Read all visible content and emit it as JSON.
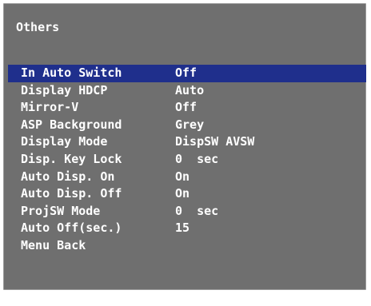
{
  "menu": {
    "title": "Others",
    "items": [
      {
        "label": "In Auto Switch",
        "value": "Off"
      },
      {
        "label": "Display HDCP",
        "value": "Auto"
      },
      {
        "label": "Mirror-V",
        "value": "Off"
      },
      {
        "label": "ASP Background",
        "value": "Grey"
      },
      {
        "label": "Display Mode",
        "value": "DispSW AVSW"
      },
      {
        "label": "Disp. Key Lock",
        "value": "0  sec"
      },
      {
        "label": "Auto Disp. On",
        "value": "On"
      },
      {
        "label": "Auto Disp. Off",
        "value": "On"
      },
      {
        "label": "ProjSW Mode",
        "value": "0  sec"
      },
      {
        "label": "Auto Off(sec.)",
        "value": "15"
      },
      {
        "label": "Menu Back",
        "value": ""
      }
    ],
    "selected_index": 0
  },
  "colors": {
    "panel_background": "#6f6f6f",
    "highlight": "#1f2f8c",
    "text": "#ffffff"
  }
}
